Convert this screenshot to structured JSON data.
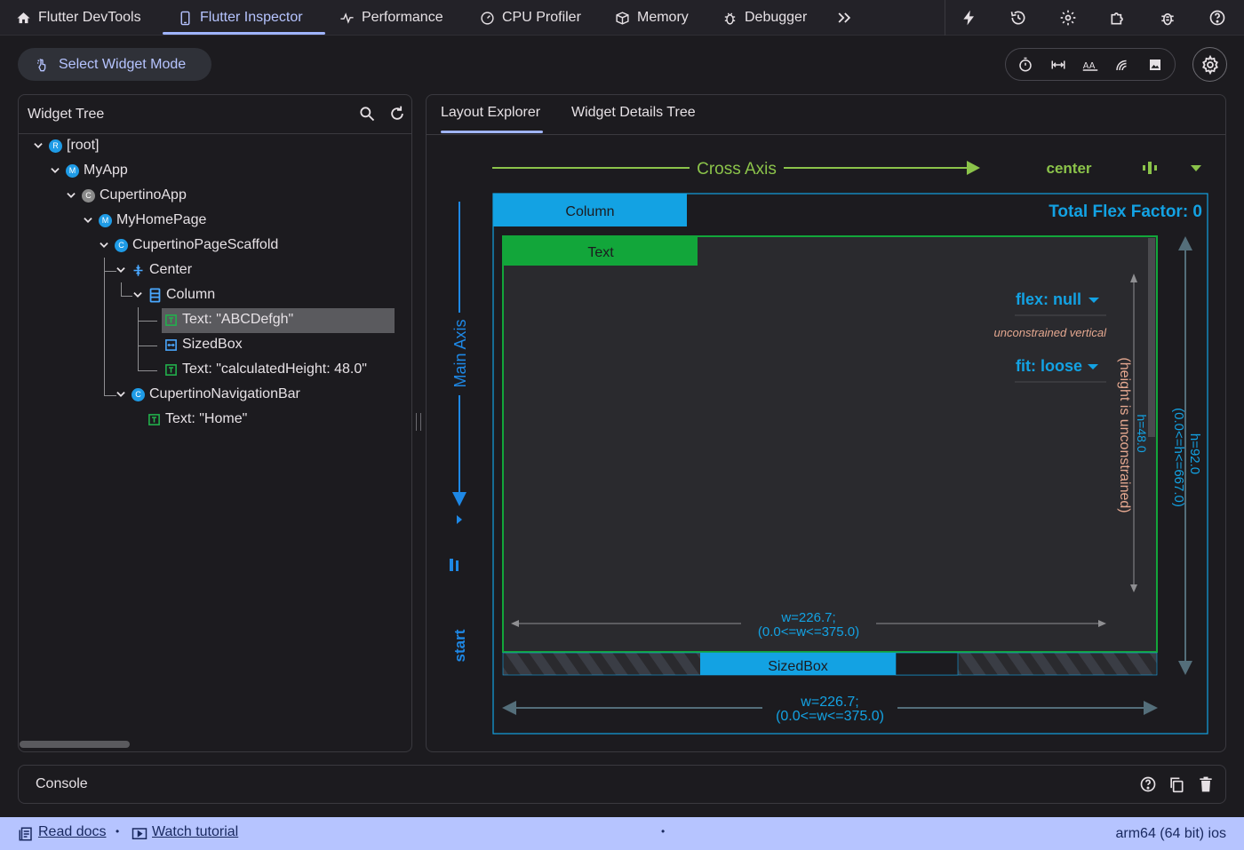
{
  "tabs": [
    {
      "label": "Flutter DevTools",
      "icon": "home-icon"
    },
    {
      "label": "Flutter Inspector",
      "icon": "phone-icon",
      "active": true
    },
    {
      "label": "Performance",
      "icon": "pulse-icon"
    },
    {
      "label": "CPU Profiler",
      "icon": "gauge-icon"
    },
    {
      "label": "Memory",
      "icon": "box-icon"
    },
    {
      "label": "Debugger",
      "icon": "bug-icon"
    }
  ],
  "toolbar": {
    "select_mode_label": "Select Widget Mode"
  },
  "tree": {
    "title": "Widget Tree",
    "nodes": [
      {
        "label": "[root]",
        "badge": "R"
      },
      {
        "label": "MyApp",
        "badge": "M"
      },
      {
        "label": "CupertinoApp",
        "badge": "C"
      },
      {
        "label": "MyHomePage",
        "badge": "M"
      },
      {
        "label": "CupertinoPageScaffold",
        "badge": "C"
      },
      {
        "label": "Center"
      },
      {
        "label": "Column"
      },
      {
        "label": "Text: \"ABCDefgh\"",
        "selected": true
      },
      {
        "label": "SizedBox"
      },
      {
        "label": "Text: \"calculatedHeight: 48.0\""
      },
      {
        "label": "CupertinoNavigationBar",
        "badge": "C"
      },
      {
        "label": "Text: \"Home\""
      }
    ]
  },
  "details": {
    "tabs": [
      "Layout Explorer",
      "Widget Details Tree"
    ],
    "cross_axis_label": "Cross Axis",
    "cross_axis_value": "center",
    "main_axis_label": "Main Axis",
    "main_axis_value": "start",
    "column_label": "Column",
    "total_flex": "Total Flex Factor: 0",
    "text_label": "Text",
    "sizedbox_label": "SizedBox",
    "flex_label": "flex: null",
    "unconstrained_label": "unconstrained vertical",
    "fit_label": "fit: loose",
    "height_unconstrained": "(height is unconstrained)",
    "inner_h": "h=48.0",
    "outer_h": "h=92.0",
    "outer_h_range": "(0.0<=h<=667.0)",
    "inner_w": "w=226.7;",
    "inner_w_range": "(0.0<=w<=375.0)",
    "outer_w": "w=226.7;",
    "outer_w_range": "(0.0<=w<=375.0)"
  },
  "console": {
    "title": "Console"
  },
  "footer": {
    "read_docs": "Read docs",
    "watch_tutorial": "Watch tutorial",
    "separator": "•",
    "center_dot": "•",
    "platform": "arm64 (64 bit) ios"
  },
  "colors": {
    "accent": "#b6c4ff",
    "cross_axis": "#8bc34a",
    "main_axis": "#1e88e5",
    "column_blue": "#13a2e3",
    "text_green": "#12a63a",
    "constraint": "#e5a890"
  }
}
